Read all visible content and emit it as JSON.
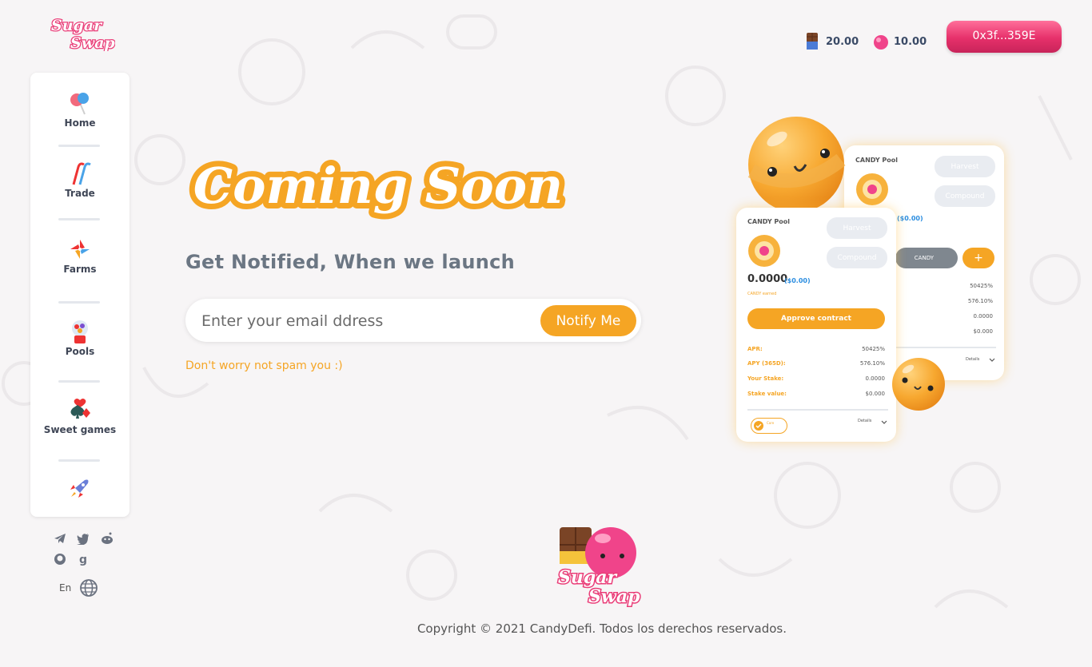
{
  "header": {
    "logo_text": "Sugar Swap",
    "balance_1": "20.00",
    "balance_2": "10.00",
    "wallet_label": "0x3f...359E"
  },
  "sidebar": {
    "items": [
      {
        "label": "Home",
        "icon": "lollipop-icon"
      },
      {
        "label": "Trade",
        "icon": "candy-cane-icon"
      },
      {
        "label": "Farms",
        "icon": "pinwheel-icon"
      },
      {
        "label": "Pools",
        "icon": "gumball-machine-icon"
      },
      {
        "label": "Sweet games",
        "icon": "card-suits-icon"
      },
      {
        "label": "",
        "icon": "rocket-icon"
      }
    ],
    "socials": [
      "telegram-icon",
      "twitter-icon",
      "reddit-icon",
      "github-icon",
      "gitbook-icon"
    ],
    "language": "En"
  },
  "main": {
    "title": "Coming Soon",
    "subtitle": "Get Notified, When we launch",
    "email_placeholder": "Enter your email ddress",
    "notify_label": "Notify Me",
    "note": "Don't worry not spam you :)"
  },
  "illustration": {
    "back_card": {
      "title": "CANDY Pool",
      "harvest": "Harvest",
      "compound": "Compound",
      "usd": "($0.00)",
      "stake_btn": "CANDY",
      "plus": "+",
      "values": [
        "50425%",
        "576.10%",
        "0.0000",
        "$0.000"
      ],
      "details": "Details"
    },
    "front_card": {
      "title": "CANDY Pool",
      "harvest": "Harvest",
      "compound": "Compound",
      "amount": "0.0000",
      "usd": "($0.00)",
      "earned": "CANDY earned",
      "approve": "Approve contract",
      "stats": [
        {
          "label": "APR:",
          "value": "50425%"
        },
        {
          "label": "APY (365D):",
          "value": "576.10%"
        },
        {
          "label": "Your Stake:",
          "value": "0.0000"
        },
        {
          "label": "Stake value:",
          "value": "$0.000"
        }
      ],
      "core": "Core",
      "details": "Details"
    }
  },
  "footer": {
    "logo_text": "Sugar Swap",
    "copyright": "Copyright © 2021 CandyDefi. Todos los derechos reservados."
  },
  "colors": {
    "accent": "#f5a524",
    "brand_pink": "#e6306a",
    "background": "#f7f5f6"
  }
}
